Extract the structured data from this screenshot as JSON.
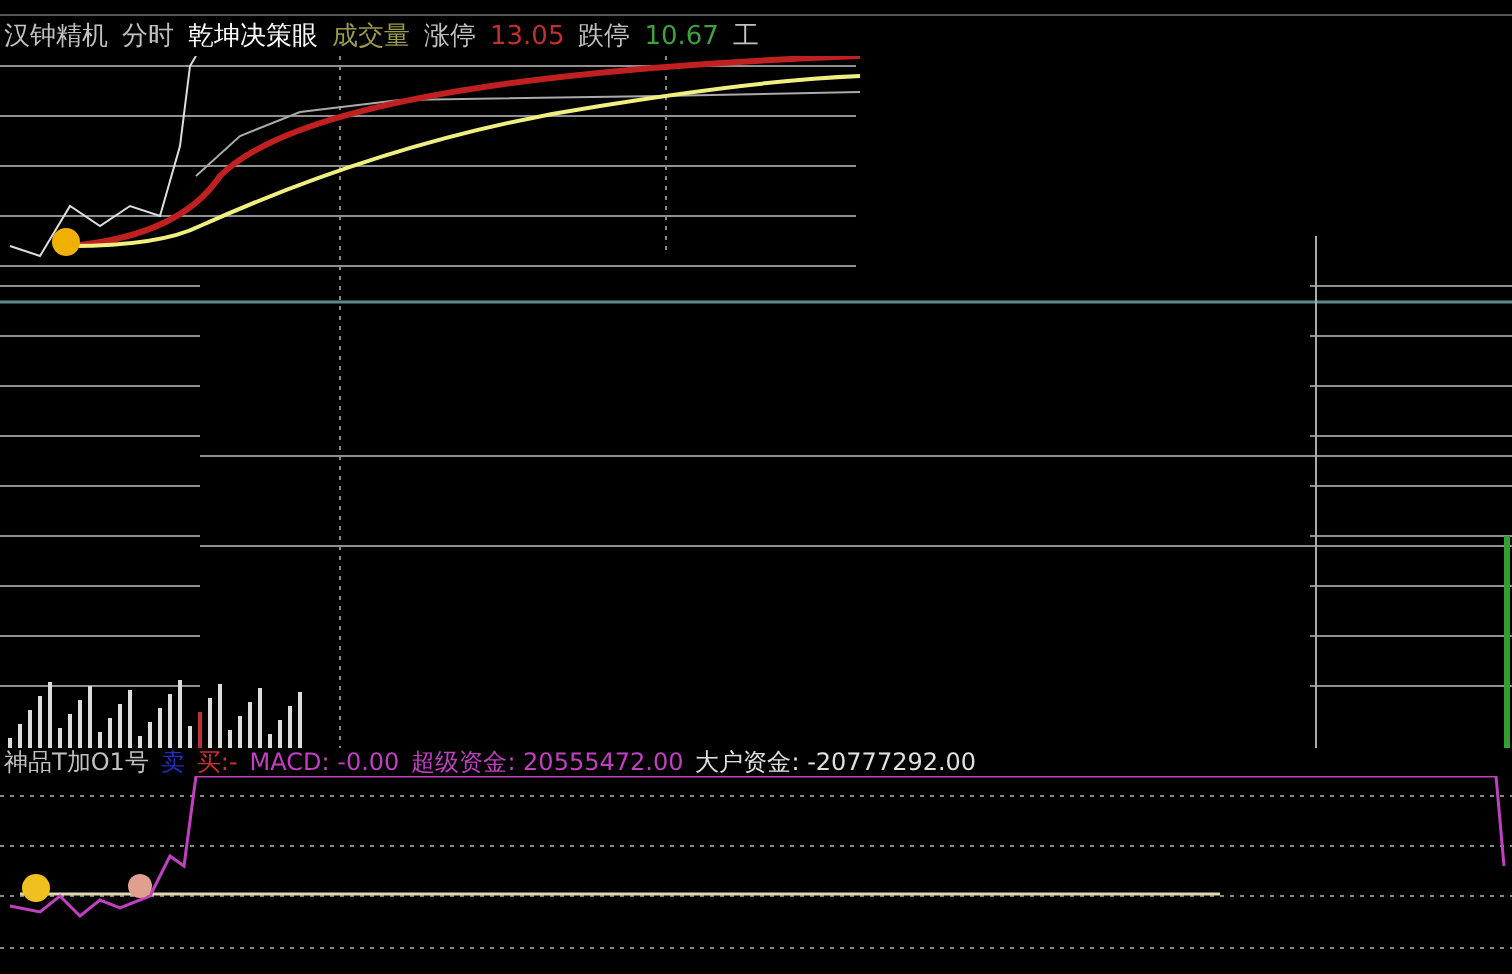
{
  "header": {
    "items": [
      {
        "text": "汉钟精机",
        "color": "#c0c0c0"
      },
      {
        "text": "分时",
        "color": "#c0c0c0"
      },
      {
        "text": "乾坤决策眼",
        "color": "#ffffff"
      },
      {
        "text": "成交量",
        "color": "#9a9a50"
      },
      {
        "text": "涨停",
        "color": "#c0c0c0"
      },
      {
        "text": "13.05",
        "color": "#c03030"
      },
      {
        "text": "跌停",
        "color": "#c0c0c0"
      },
      {
        "text": "10.67",
        "color": "#40a040"
      },
      {
        "text": "工",
        "color": "#c0c0c0"
      }
    ]
  },
  "indicator": {
    "items": [
      {
        "text": "神品T加O1号",
        "color": "#c0c0c0"
      },
      {
        "text": "卖",
        "color": "#2030c0"
      },
      {
        "text": "买:-",
        "color": "#d03030"
      },
      {
        "text": "MACD: -0.00",
        "color": "#c040c0"
      },
      {
        "text": "超级资金: 20555472.00",
        "color": "#c040c0"
      },
      {
        "text": "大户资金: -20777292.00",
        "color": "#e0e0e0"
      }
    ]
  }
}
